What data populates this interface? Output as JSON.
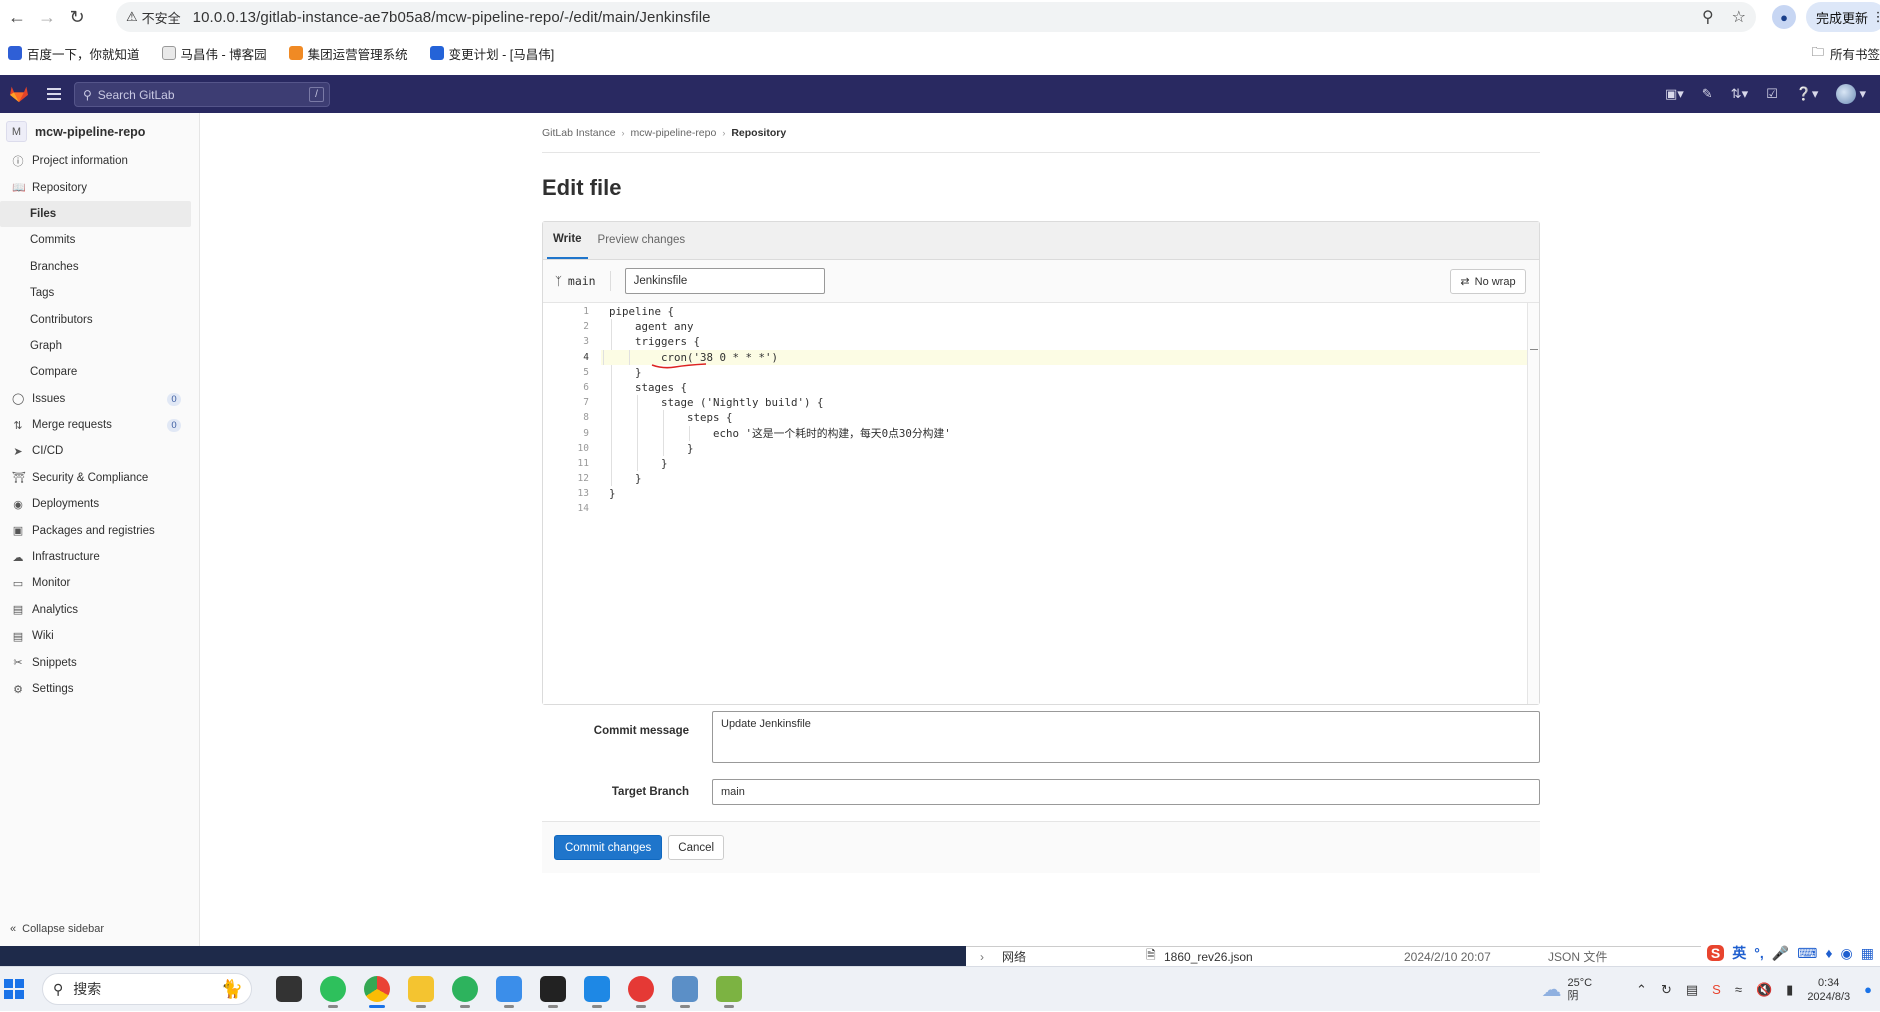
{
  "browser": {
    "insecure_label": "不安全",
    "url": "10.0.0.13/gitlab-instance-ae7b05a8/mcw-pipeline-repo/-/edit/main/Jenkinsfile",
    "update_label": "完成更新",
    "bookmarks": [
      "百度一下，你就知道",
      "马昌伟 - 博客园",
      "集团运营管理系统",
      "变更计划 - [马昌伟]"
    ],
    "bookmarks_folder": "所有书签"
  },
  "gitlab": {
    "search_placeholder": "Search GitLab",
    "search_shortcut": "/"
  },
  "sidebar": {
    "project_initial": "M",
    "project_name": "mcw-pipeline-repo",
    "items": [
      {
        "label": "Project information",
        "icon": "info-icon"
      },
      {
        "label": "Repository",
        "icon": "book-icon"
      },
      {
        "label": "Issues",
        "icon": "issues-icon",
        "count": "0"
      },
      {
        "label": "Merge requests",
        "icon": "merge-request-icon",
        "count": "0"
      },
      {
        "label": "CI/CD",
        "icon": "rocket-icon"
      },
      {
        "label": "Security & Compliance",
        "icon": "shield-icon"
      },
      {
        "label": "Deployments",
        "icon": "deployments-icon"
      },
      {
        "label": "Packages and registries",
        "icon": "package-icon"
      },
      {
        "label": "Infrastructure",
        "icon": "cloud-icon"
      },
      {
        "label": "Monitor",
        "icon": "monitor-icon"
      },
      {
        "label": "Analytics",
        "icon": "chart-icon"
      },
      {
        "label": "Wiki",
        "icon": "wiki-icon"
      },
      {
        "label": "Snippets",
        "icon": "snippet-icon"
      },
      {
        "label": "Settings",
        "icon": "settings-icon"
      }
    ],
    "repo_subitems": [
      "Files",
      "Commits",
      "Branches",
      "Tags",
      "Contributors",
      "Graph",
      "Compare"
    ],
    "collapse_label": "Collapse sidebar"
  },
  "breadcrumb": [
    "GitLab Instance",
    "mcw-pipeline-repo",
    "Repository"
  ],
  "page_title": "Edit file",
  "editor": {
    "tabs": [
      "Write",
      "Preview changes"
    ],
    "branch": "main",
    "file_name": "Jenkinsfile",
    "nowrap_label": "No wrap",
    "cursor_line": 4,
    "lines": [
      "pipeline {",
      "    agent any",
      "    triggers {",
      "        cron('38 0 * * *')",
      "    }",
      "    stages {",
      "        stage ('Nightly build') {",
      "            steps {",
      "                echo '这是一个耗时的构建，每天0点30分构建'",
      "            }",
      "        }",
      "    }",
      "}",
      ""
    ]
  },
  "form": {
    "commit_message_label": "Commit message",
    "commit_message": "Update Jenkinsfile",
    "target_branch_label": "Target Branch",
    "target_branch": "main",
    "commit_button": "Commit changes",
    "cancel_button": "Cancel"
  },
  "background_window": {
    "file_name": "1860_rev26.json",
    "modified": "2024/2/10 20:07",
    "file_type": "JSON 文件",
    "tree_item": "网络"
  },
  "ime": {
    "mode": "英"
  },
  "taskbar": {
    "search_label": "搜索",
    "weather_temp": "25°C",
    "weather_desc": "阴",
    "time": "0:34",
    "date": "2024/8/3"
  }
}
